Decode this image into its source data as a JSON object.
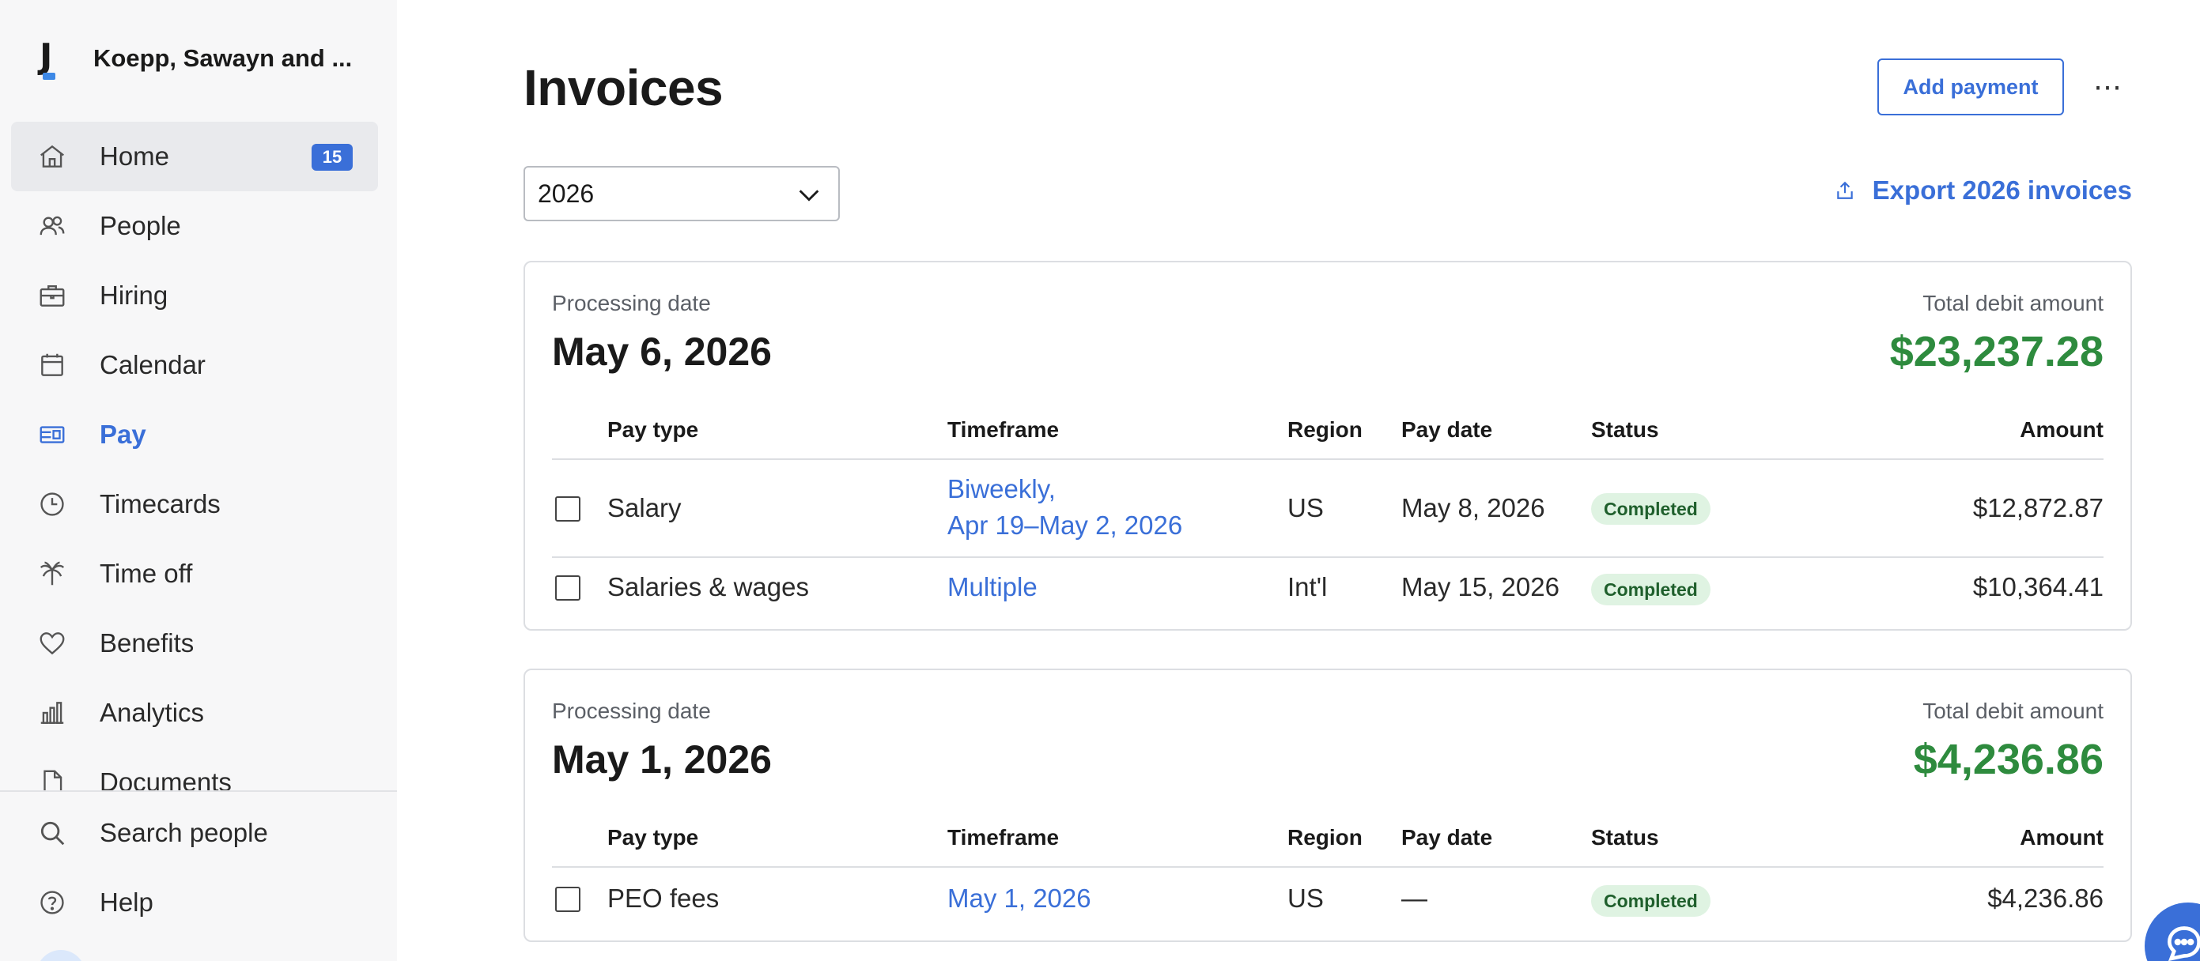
{
  "sidebar": {
    "company": "Koepp, Sawayn and ...",
    "items": [
      {
        "label": "Home",
        "icon": "home-icon",
        "badge": "15"
      },
      {
        "label": "People",
        "icon": "people-icon"
      },
      {
        "label": "Hiring",
        "icon": "briefcase-icon"
      },
      {
        "label": "Calendar",
        "icon": "calendar-icon"
      },
      {
        "label": "Pay",
        "icon": "pay-icon"
      },
      {
        "label": "Timecards",
        "icon": "clock-icon"
      },
      {
        "label": "Time off",
        "icon": "palm-tree-icon"
      },
      {
        "label": "Benefits",
        "icon": "heart-icon"
      },
      {
        "label": "Analytics",
        "icon": "bar-chart-icon"
      },
      {
        "label": "Documents",
        "icon": "document-icon"
      }
    ],
    "bottom": [
      {
        "label": "Search people",
        "icon": "search-icon"
      },
      {
        "label": "Help",
        "icon": "help-icon"
      }
    ]
  },
  "main": {
    "title": "Invoices",
    "add_payment_label": "Add payment",
    "more_label": "⋯",
    "year_selected": "2026",
    "export_label": "Export 2026 invoices",
    "columns": [
      "Pay type",
      "Timeframe",
      "Region",
      "Pay date",
      "Status",
      "Amount"
    ],
    "groups": [
      {
        "processing_label": "Processing date",
        "processing_date": "May 6, 2026",
        "total_label": "Total debit amount",
        "total_amount": "$23,237.28",
        "rows": [
          {
            "pay_type": "Salary",
            "timeframe_line1": "Biweekly,",
            "timeframe_line2": "Apr 19–May 2, 2026",
            "region": "US",
            "pay_date": "May 8, 2026",
            "status": "Completed",
            "amount": "$12,872.87"
          },
          {
            "pay_type": "Salaries & wages",
            "timeframe": "Multiple",
            "region": "Int'l",
            "pay_date": "May 15, 2026",
            "status": "Completed",
            "amount": "$10,364.41"
          }
        ]
      },
      {
        "processing_label": "Processing date",
        "processing_date": "May 1, 2026",
        "total_label": "Total debit amount",
        "total_amount": "$4,236.86",
        "rows": [
          {
            "pay_type": "PEO fees",
            "timeframe": "May 1, 2026",
            "region": "US",
            "pay_date": "—",
            "status": "Completed",
            "amount": "$4,236.86"
          }
        ]
      }
    ]
  },
  "colors": {
    "accent": "#3a6fd8",
    "total_green": "#2e8b3e",
    "status_bg": "#dff3e2",
    "sidebar_bg": "#f7f7f8"
  }
}
